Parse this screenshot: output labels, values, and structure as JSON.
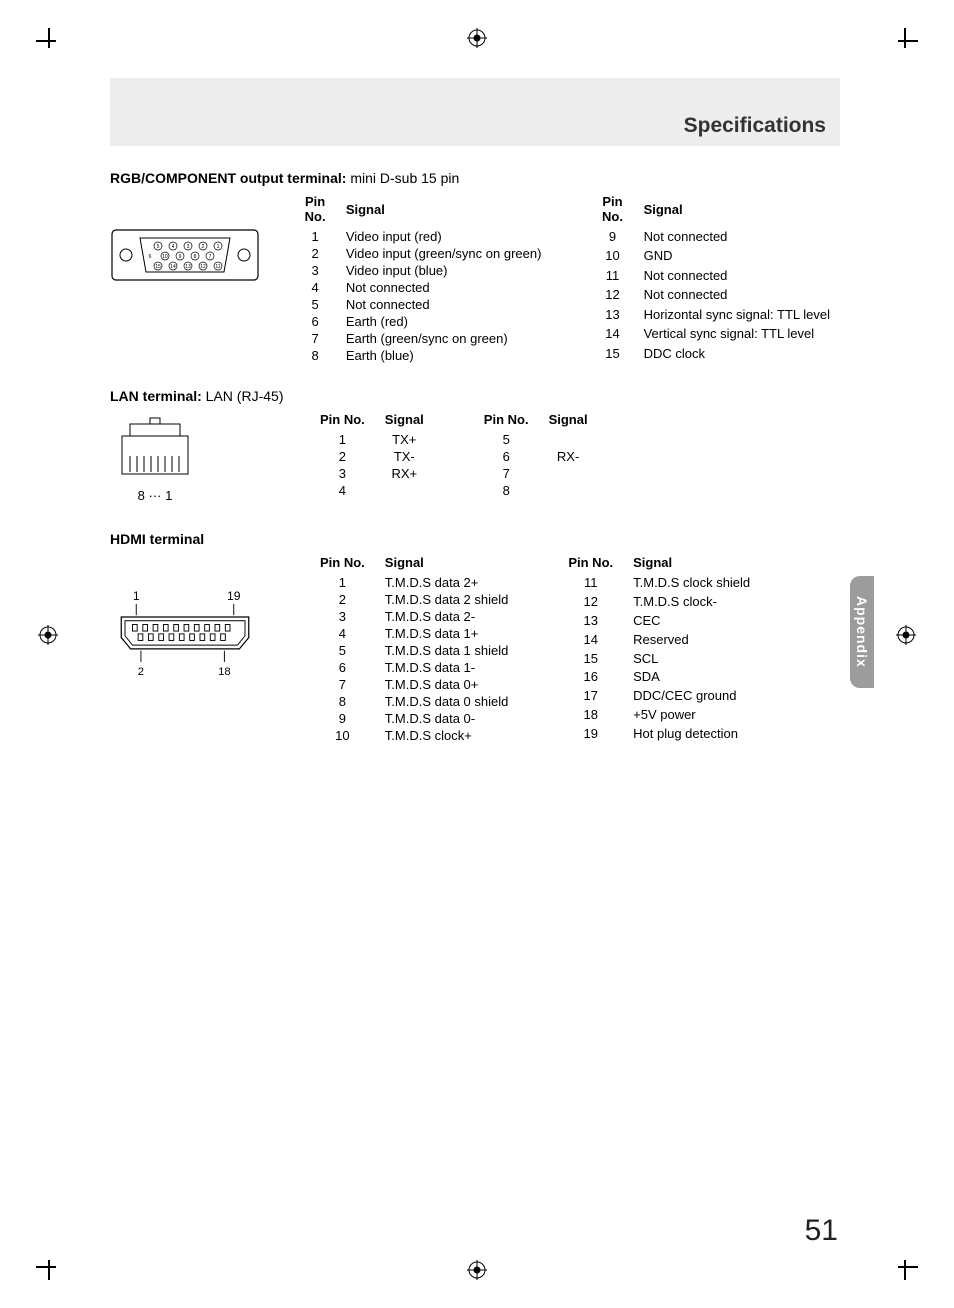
{
  "header": {
    "title": "Specifications"
  },
  "sideTab": "Appendix",
  "pageNumber": "51",
  "sections": {
    "rgb": {
      "title_bold": "RGB/COMPONENT output terminal:",
      "title_rest": " mini D-sub 15 pin",
      "headers": {
        "pin": "Pin No.",
        "sig": "Signal"
      },
      "left": [
        {
          "pin": "1",
          "sig": "Video input (red)"
        },
        {
          "pin": "2",
          "sig": "Video input (green/sync on green)"
        },
        {
          "pin": "3",
          "sig": "Video input (blue)"
        },
        {
          "pin": "4",
          "sig": "Not connected"
        },
        {
          "pin": "5",
          "sig": "Not connected"
        },
        {
          "pin": "6",
          "sig": "Earth (red)"
        },
        {
          "pin": "7",
          "sig": "Earth (green/sync on green)"
        },
        {
          "pin": "8",
          "sig": "Earth (blue)"
        }
      ],
      "right": [
        {
          "pin": "9",
          "sig": "Not connected"
        },
        {
          "pin": "10",
          "sig": "GND"
        },
        {
          "pin": "11",
          "sig": "Not connected"
        },
        {
          "pin": "12",
          "sig": "Not connected"
        },
        {
          "pin": "13",
          "sig": "Horizontal sync signal: TTL level"
        },
        {
          "pin": "14",
          "sig": "Vertical sync signal: TTL level"
        },
        {
          "pin": "15",
          "sig": "DDC clock"
        }
      ]
    },
    "lan": {
      "title_bold": "LAN terminal:",
      "title_rest": " LAN (RJ-45)",
      "headers": {
        "pin": "Pin No.",
        "sig": "Signal"
      },
      "diagram_label": "8 ··· 1",
      "left": [
        {
          "pin": "1",
          "sig": "TX+"
        },
        {
          "pin": "2",
          "sig": "TX-"
        },
        {
          "pin": "3",
          "sig": "RX+"
        },
        {
          "pin": "4",
          "sig": ""
        }
      ],
      "right": [
        {
          "pin": "5",
          "sig": ""
        },
        {
          "pin": "6",
          "sig": "RX-"
        },
        {
          "pin": "7",
          "sig": ""
        },
        {
          "pin": "8",
          "sig": ""
        }
      ]
    },
    "hdmi": {
      "title_bold": "HDMI terminal",
      "title_rest": "",
      "headers": {
        "pin": "Pin No.",
        "sig": "Signal"
      },
      "diagram_labels": {
        "tl": "1",
        "tr": "19",
        "bl": "2",
        "br": "18"
      },
      "left": [
        {
          "pin": "1",
          "sig": "T.M.D.S data 2+"
        },
        {
          "pin": "2",
          "sig": "T.M.D.S data 2 shield"
        },
        {
          "pin": "3",
          "sig": "T.M.D.S data 2-"
        },
        {
          "pin": "4",
          "sig": "T.M.D.S data 1+"
        },
        {
          "pin": "5",
          "sig": "T.M.D.S data 1 shield"
        },
        {
          "pin": "6",
          "sig": "T.M.D.S data 1-"
        },
        {
          "pin": "7",
          "sig": "T.M.D.S data 0+"
        },
        {
          "pin": "8",
          "sig": "T.M.D.S data 0 shield"
        },
        {
          "pin": "9",
          "sig": "T.M.D.S data 0-"
        },
        {
          "pin": "10",
          "sig": "T.M.D.S clock+"
        }
      ],
      "right": [
        {
          "pin": "11",
          "sig": "T.M.D.S clock shield"
        },
        {
          "pin": "12",
          "sig": "T.M.D.S clock-"
        },
        {
          "pin": "13",
          "sig": "CEC"
        },
        {
          "pin": "14",
          "sig": "Reserved"
        },
        {
          "pin": "15",
          "sig": "SCL"
        },
        {
          "pin": "16",
          "sig": "SDA"
        },
        {
          "pin": "17",
          "sig": "DDC/CEC ground"
        },
        {
          "pin": "18",
          "sig": "+5V power"
        },
        {
          "pin": "19",
          "sig": "Hot plug detection"
        }
      ]
    }
  }
}
